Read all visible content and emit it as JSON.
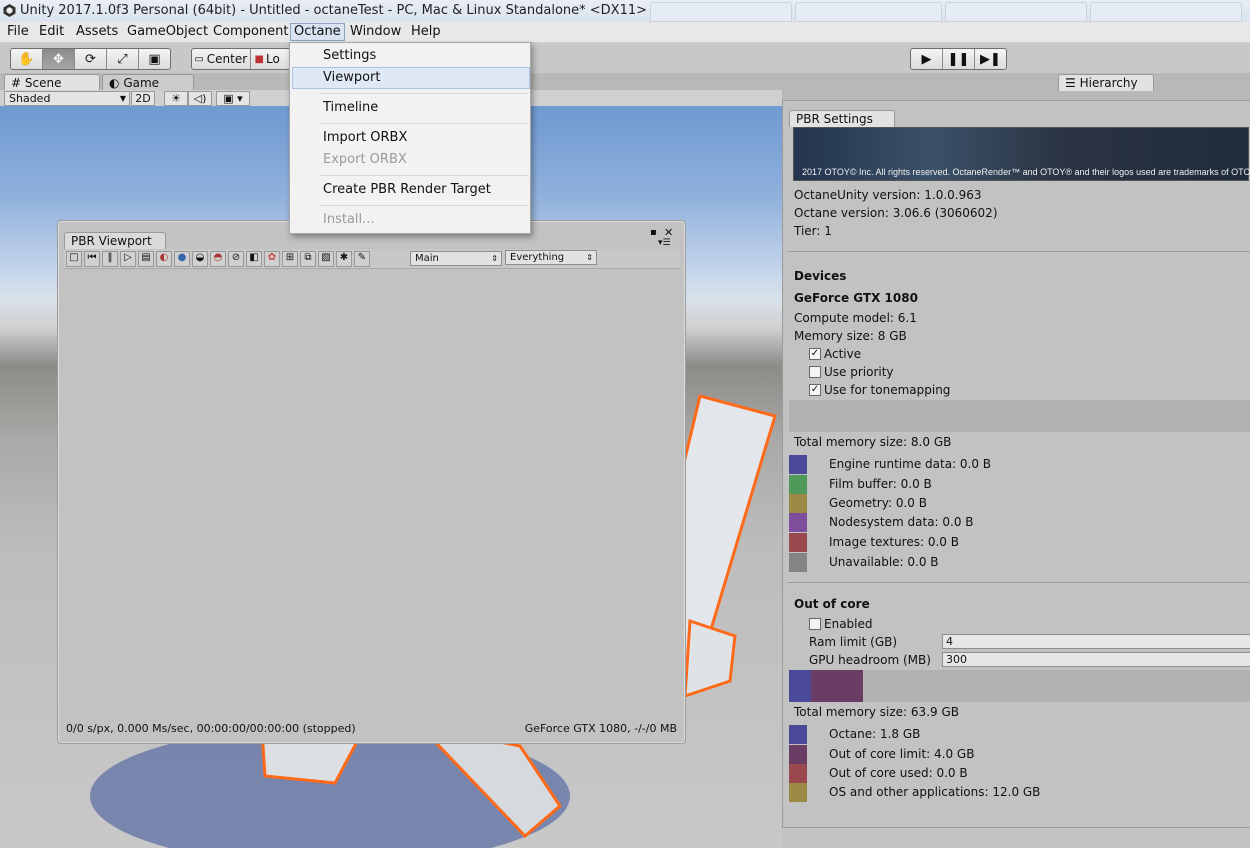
{
  "window": {
    "title": "Unity 2017.1.0f3 Personal (64bit) - Untitled - octaneTest - PC, Mac & Linux Standalone* <DX11>"
  },
  "menubar": [
    "File",
    "Edit",
    "Assets",
    "GameObject",
    "Component",
    "Octane",
    "Window",
    "Help"
  ],
  "toolbar": {
    "pivot_label": "Center",
    "local_label": "Lo"
  },
  "octane_menu": {
    "items": [
      "Settings",
      "Viewport",
      "Timeline",
      "Import ORBX",
      "Export ORBX",
      "Create PBR Render Target",
      "Install..."
    ]
  },
  "scene_tabs": {
    "scene": "Scene",
    "game": "Game",
    "shading": "Shaded",
    "mode_2d": "2D"
  },
  "hierarchy": {
    "tab": "Hierarchy"
  },
  "pbr_viewport": {
    "tab": "PBR Viewport",
    "camera_select": "Main",
    "layer_select": "Everything",
    "status_left": "0/0 s/px, 0.000 Ms/sec, 00:00:00/00:00:00 (stopped)",
    "status_right": "GeForce GTX 1080, -/-/0 MB"
  },
  "pbr_settings": {
    "tab": "PBR Settings",
    "banner_text": "2017 OTOY© Inc. All rights reserved. OctaneRender™ and OTOY® and their logos used are trademarks of OTOY®",
    "octaneunity_version": "OctaneUnity version: 1.0.0.963",
    "octane_version": "Octane version: 3.06.6 (3060602)",
    "tier": "Tier: 1",
    "devices_header": "Devices",
    "gpu_name": "GeForce GTX 1080",
    "compute_model": "Compute model: 6.1",
    "memory_size": "Memory size: 8 GB",
    "active_label": "Active",
    "use_priority_label": "Use priority",
    "use_tonemapping_label": "Use for tonemapping",
    "active_checked": true,
    "use_priority_checked": false,
    "use_tonemapping_checked": true,
    "total_memory_1": "Total memory size: 8.0 GB",
    "memory_items": [
      {
        "label": "Engine runtime data: 0.0 B",
        "color": "#4a4a98"
      },
      {
        "label": "Film buffer: 0.0 B",
        "color": "#4f9a5b"
      },
      {
        "label": "Geometry: 0.0 B",
        "color": "#9a8a45"
      },
      {
        "label": "Nodesystem data: 0.0 B",
        "color": "#7c4e9c"
      },
      {
        "label": "Image textures: 0.0 B",
        "color": "#9a4a4e"
      },
      {
        "label": "Unavailable: 0.0 B",
        "color": "#848484"
      }
    ],
    "out_of_core_header": "Out of core",
    "enabled_label": "Enabled",
    "ram_limit_label": "Ram limit (GB)",
    "ram_limit_value": "4",
    "gpu_headroom_label": "GPU headroom (MB)",
    "gpu_headroom_value": "300",
    "total_memory_2": "Total memory size: 63.9 GB",
    "core_items": [
      {
        "label": "Octane: 1.8 GB",
        "color": "#4a4a98"
      },
      {
        "label": "Out of core limit: 4.0 GB",
        "color": "#6a3e64"
      },
      {
        "label": "Out of core used: 0.0 B",
        "color": "#9a4a4e"
      },
      {
        "label": "OS and other applications: 12.0 GB",
        "color": "#9a8a45"
      }
    ]
  }
}
